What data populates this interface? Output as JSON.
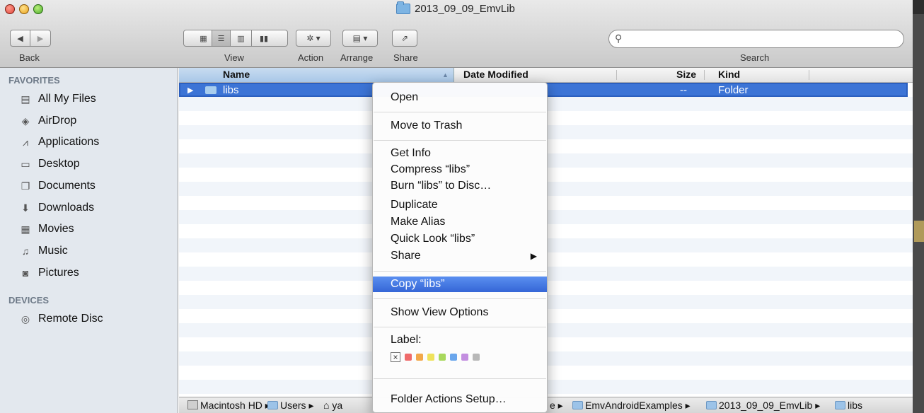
{
  "window": {
    "title": "2013_09_09_EmvLib"
  },
  "toolbar": {
    "back_label": "Back",
    "view_label": "View",
    "action_label": "Action",
    "arrange_label": "Arrange",
    "share_label": "Share",
    "search_label": "Search",
    "search_value": ""
  },
  "sidebar": {
    "favorites_heading": "FAVORITES",
    "favorites": [
      {
        "label": "All My Files",
        "icon": "all-files-icon"
      },
      {
        "label": "AirDrop",
        "icon": "airdrop-icon"
      },
      {
        "label": "Applications",
        "icon": "applications-icon"
      },
      {
        "label": "Desktop",
        "icon": "desktop-icon"
      },
      {
        "label": "Documents",
        "icon": "documents-icon"
      },
      {
        "label": "Downloads",
        "icon": "downloads-icon"
      },
      {
        "label": "Movies",
        "icon": "movies-icon"
      },
      {
        "label": "Music",
        "icon": "music-icon"
      },
      {
        "label": "Pictures",
        "icon": "pictures-icon"
      }
    ],
    "devices_heading": "DEVICES",
    "devices": [
      {
        "label": "Remote Disc",
        "icon": "remote-disc-icon"
      }
    ]
  },
  "columns": {
    "name": "Name",
    "date": "Date Modified",
    "size": "Size",
    "kind": "Kind"
  },
  "files": [
    {
      "name": "libs",
      "size": "--",
      "kind": "Folder"
    }
  ],
  "context_menu": {
    "open": "Open",
    "trash": "Move to Trash",
    "get_info": "Get Info",
    "compress": "Compress “libs”",
    "burn": "Burn “libs” to Disc…",
    "duplicate": "Duplicate",
    "make_alias": "Make Alias",
    "quick_look": "Quick Look “libs”",
    "share": "Share",
    "copy": "Copy “libs”",
    "view_options": "Show View Options",
    "label_heading": "Label:",
    "folder_actions": "Folder Actions Setup…",
    "label_colors": [
      "#ef6b6b",
      "#f2a84a",
      "#efe25b",
      "#a8d85c",
      "#6aa6ec",
      "#c38ee0",
      "#b8b8b8"
    ]
  },
  "pathbar": {
    "items": [
      "Macintosh HD",
      "Users",
      "ya",
      "e",
      "EmvAndroidExamples",
      "2013_09_09_EmvLib",
      "libs"
    ]
  }
}
